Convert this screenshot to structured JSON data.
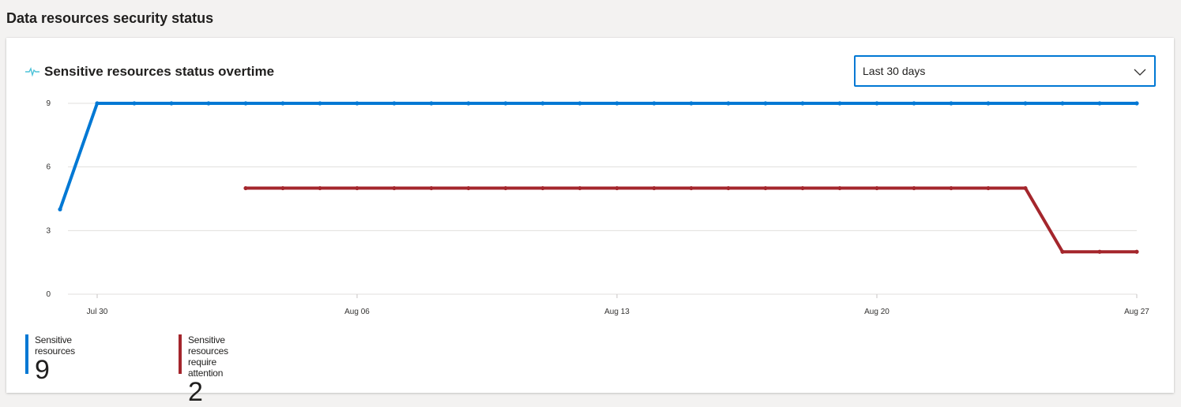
{
  "page": {
    "section_title": "Data resources security status"
  },
  "card": {
    "title": "Sensitive resources status overtime",
    "title_icon": "pulse-line-icon",
    "dropdown": {
      "selected": "Last 30 days",
      "icon": "chevron-down-icon"
    }
  },
  "chart_data": {
    "type": "line",
    "x_tick_labels": [
      "Jul 30",
      "Aug 06",
      "Aug 13",
      "Aug 20",
      "Aug 27"
    ],
    "y_ticks": [
      0,
      3,
      6,
      9
    ],
    "ylim": [
      0,
      9
    ],
    "x": [
      "Jul 29",
      "Jul 30",
      "Jul 31",
      "Aug 01",
      "Aug 02",
      "Aug 03",
      "Aug 04",
      "Aug 05",
      "Aug 06",
      "Aug 07",
      "Aug 08",
      "Aug 09",
      "Aug 10",
      "Aug 11",
      "Aug 12",
      "Aug 13",
      "Aug 14",
      "Aug 15",
      "Aug 16",
      "Aug 17",
      "Aug 18",
      "Aug 19",
      "Aug 20",
      "Aug 21",
      "Aug 22",
      "Aug 23",
      "Aug 24",
      "Aug 25",
      "Aug 26",
      "Aug 27"
    ],
    "grid": true,
    "series": [
      {
        "name": "Sensitive resources",
        "color": "#0078d4",
        "values": [
          4,
          9,
          9,
          9,
          9,
          9,
          9,
          9,
          9,
          9,
          9,
          9,
          9,
          9,
          9,
          9,
          9,
          9,
          9,
          9,
          9,
          9,
          9,
          9,
          9,
          9,
          9,
          9,
          9,
          9
        ]
      },
      {
        "name": "Sensitive resources require attention",
        "color": "#a4262c",
        "values": [
          null,
          null,
          null,
          null,
          null,
          5,
          5,
          5,
          5,
          5,
          5,
          5,
          5,
          5,
          5,
          5,
          5,
          5,
          5,
          5,
          5,
          5,
          5,
          5,
          5,
          5,
          5,
          2,
          2,
          2
        ]
      }
    ]
  },
  "legend": [
    {
      "label": "Sensitive resources",
      "value": "9",
      "color": "#0078d4"
    },
    {
      "label": "Sensitive resources require attention",
      "value": "2",
      "color": "#a4262c"
    }
  ]
}
